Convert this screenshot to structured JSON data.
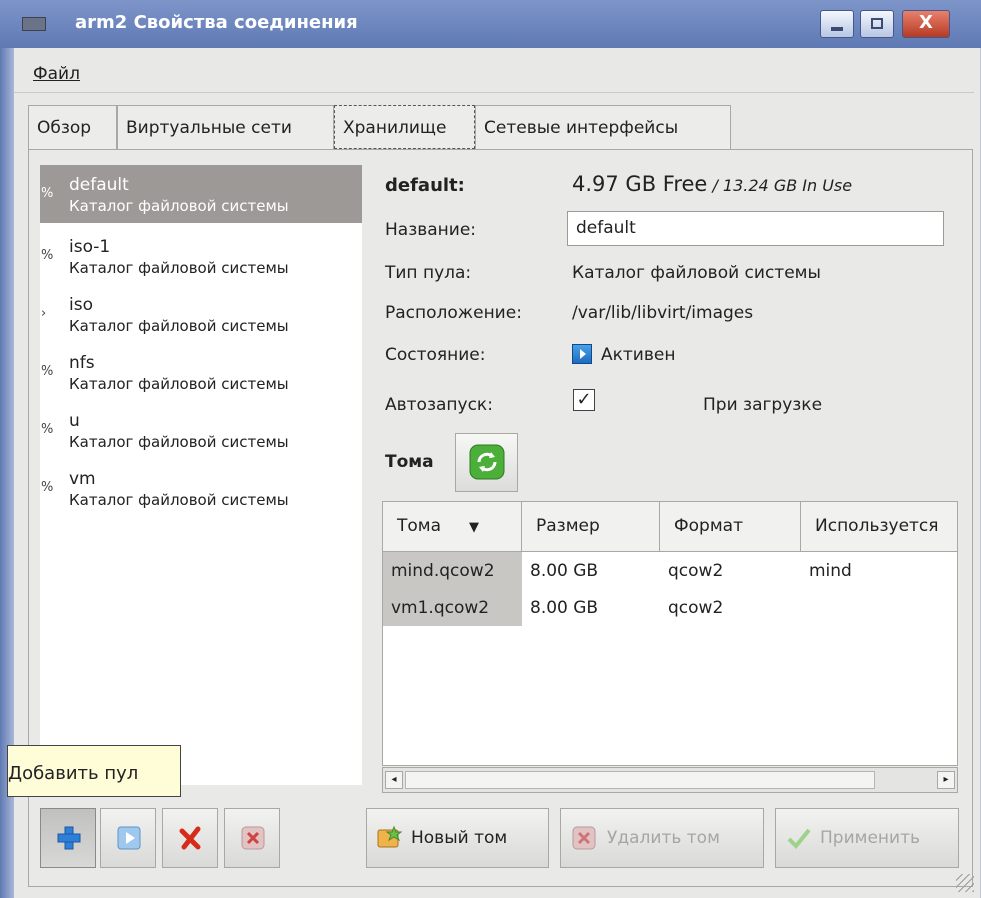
{
  "window": {
    "title": "arm2 Свойства соединения",
    "min_glyph": "_",
    "max_glyph": "□",
    "close_glyph": "X"
  },
  "menu": {
    "file": "Файл"
  },
  "tabs": [
    {
      "label": "Обзор",
      "active": false
    },
    {
      "label": "Виртуальные сети",
      "active": false
    },
    {
      "label": "Хранилище",
      "active": true
    },
    {
      "label": "Сетевые интерфейсы",
      "active": false
    }
  ],
  "pools": [
    {
      "mark": "%",
      "name": "default",
      "type": "Каталог файловой системы",
      "selected": true
    },
    {
      "mark": "%",
      "name": "iso-1",
      "type": "Каталог файловой системы",
      "selected": false
    },
    {
      "mark": "›",
      "name": "iso",
      "type": "Каталог файловой системы",
      "selected": false
    },
    {
      "mark": "%",
      "name": "nfs",
      "type": "Каталог файловой системы",
      "selected": false
    },
    {
      "mark": "%",
      "name": "u",
      "type": "Каталог файловой системы",
      "selected": false
    },
    {
      "mark": "%",
      "name": "vm",
      "type": "Каталог файловой системы",
      "selected": false
    }
  ],
  "tooltip": "Добавить пул",
  "details": {
    "header": "default:",
    "free": "4.97 GB Free",
    "in_use": " / 13.24 GB In Use",
    "name_label": "Название:",
    "name_value": "default",
    "type_label": "Тип пула:",
    "type_value": "Каталог файловой системы",
    "location_label": "Расположение:",
    "location_value": "/var/lib/libvirt/images",
    "state_label": "Состояние:",
    "state_value": "Активен",
    "autostart_label": "Автозапуск:",
    "autostart_checked": "✓",
    "autostart_value": "При загрузке"
  },
  "volumes": {
    "section_label": "Тома",
    "columns": [
      "Тома",
      "Размер",
      "Формат",
      "Используется"
    ],
    "sort_indicator": "▼",
    "rows": [
      {
        "name": "mind.qcow2",
        "size": "8.00 GB",
        "format": "qcow2",
        "used_by": "mind"
      },
      {
        "name": "vm1.qcow2",
        "size": "8.00 GB",
        "format": "qcow2",
        "used_by": ""
      }
    ]
  },
  "buttons": {
    "new_volume": "Новый том",
    "delete_volume": "Удалить том",
    "apply": "Применить"
  },
  "colors": {
    "title_bar": "#5f79b4",
    "selection": "#9c9996",
    "tooltip_bg": "#fffcd8"
  }
}
